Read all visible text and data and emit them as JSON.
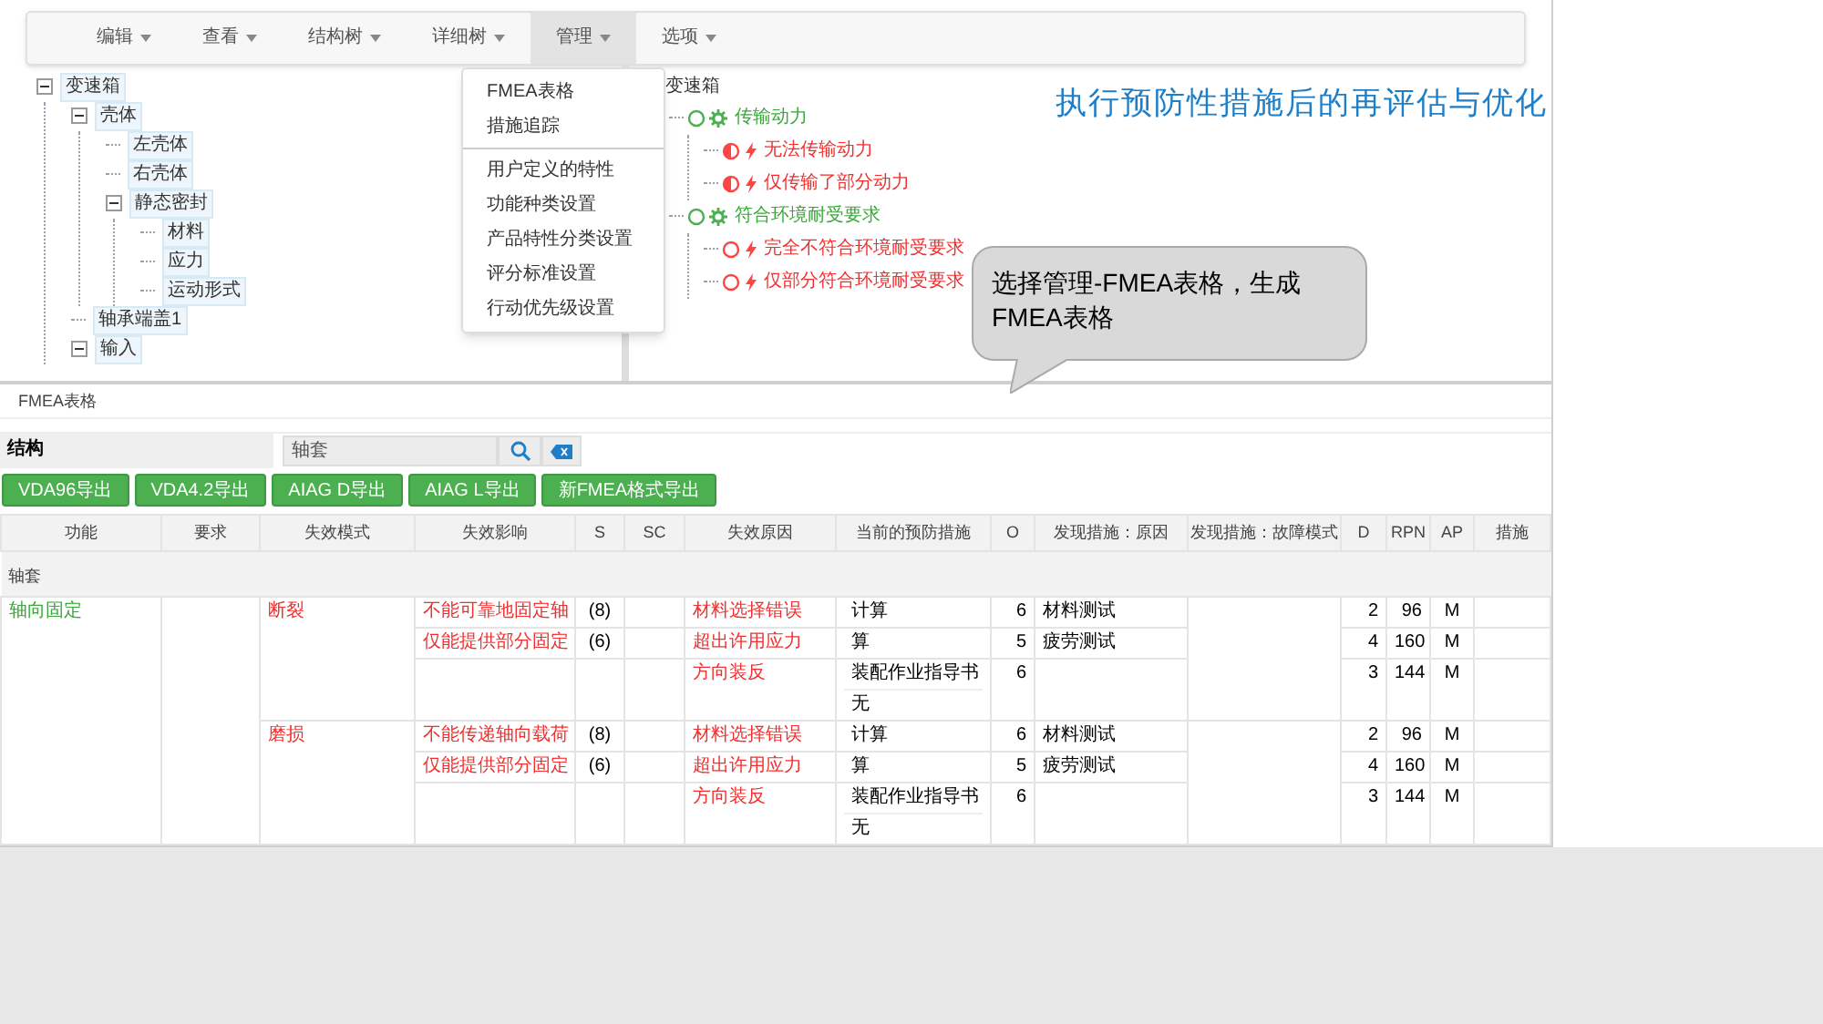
{
  "menu_bar": [
    {
      "label": "编辑",
      "selected": false
    },
    {
      "label": "查看",
      "selected": false
    },
    {
      "label": "结构树",
      "selected": false
    },
    {
      "label": "详细树",
      "selected": false
    },
    {
      "label": "管理",
      "selected": true
    },
    {
      "label": "选项",
      "selected": false
    }
  ],
  "dropdown": [
    [
      "FMEA表格",
      "措施追踪"
    ],
    [
      "用户定义的特性",
      "功能种类设置",
      "产品特性分类设置",
      "评分标准设置",
      "行动优先级设置"
    ]
  ],
  "structure_tree": [
    {
      "label": "变速箱",
      "expanded": true,
      "children": [
        {
          "label": "壳体",
          "expanded": true,
          "children": [
            {
              "label": "左壳体"
            },
            {
              "label": "右壳体"
            },
            {
              "label": "静态密封",
              "expanded": true,
              "children": [
                {
                  "label": "材料"
                },
                {
                  "label": "应力"
                },
                {
                  "label": "运动形式"
                }
              ]
            }
          ]
        },
        {
          "label": "轴承端盖1"
        },
        {
          "label": "输入",
          "expanded": true
        }
      ]
    }
  ],
  "function_tree": {
    "root": "变速箱",
    "items": [
      {
        "kind": "function",
        "label": "传输动力",
        "children": [
          {
            "kind": "failure",
            "label": "无法传输动力",
            "assessed": true
          },
          {
            "kind": "failure",
            "label": "仅传输了部分动力",
            "assessed": true
          }
        ]
      },
      {
        "kind": "function",
        "label": "符合环境耐受要求",
        "children": [
          {
            "kind": "failure",
            "label": "完全不符合环境耐受要求",
            "assessed": false
          },
          {
            "kind": "failure",
            "label": "仅部分符合环境耐受要求",
            "assessed": false
          }
        ]
      }
    ]
  },
  "slide_title": "执行预防性措施后的再评估与优化",
  "callout": "选择管理-FMEA表格，生成FMEA表格",
  "fmea_panel": {
    "title": "FMEA表格",
    "structure_label": "结构",
    "search_value": "轴套",
    "export_buttons": [
      "VDA96导出",
      "VDA4.2导出",
      "AIAG D导出",
      "AIAG L导出",
      "新FMEA格式导出"
    ],
    "columns": [
      "功能",
      "要求",
      "失效模式",
      "失效影响",
      "S",
      "SC",
      "失效原因",
      "当前的预防措施",
      "O",
      "发现措施：原因",
      "发现措施：故障模式",
      "D",
      "RPN",
      "AP",
      "措施"
    ],
    "group_label": "轴套",
    "function": "轴向固定",
    "failure_modes": [
      {
        "mode": "断裂",
        "rows": [
          {
            "effect": "不能可靠地固定轴",
            "s": "(8)",
            "cause": "材料选择错误",
            "prevention": [
              "计算"
            ],
            "o": "6",
            "detection_cause": "材料测试",
            "d": "2",
            "rpn": "96",
            "ap": "M"
          },
          {
            "effect": "仅能提供部分固定",
            "s": "(6)",
            "cause": "超出许用应力",
            "prevention": [
              "算"
            ],
            "o": "5",
            "detection_cause": "疲劳测试",
            "d": "4",
            "rpn": "160",
            "ap": "M"
          },
          {
            "cause": "方向装反",
            "prevention": [
              "装配作业指导书",
              "无"
            ],
            "o": "6",
            "d": "3",
            "rpn": "144",
            "ap": "M"
          }
        ]
      },
      {
        "mode": "磨损",
        "rows": [
          {
            "effect": "不能传递轴向载荷",
            "s": "(8)",
            "cause": "材料选择错误",
            "prevention": [
              "计算"
            ],
            "o": "6",
            "detection_cause": "材料测试",
            "d": "2",
            "rpn": "96",
            "ap": "M"
          },
          {
            "effect": "仅能提供部分固定",
            "s": "(6)",
            "cause": "超出许用应力",
            "prevention": [
              "算"
            ],
            "o": "5",
            "detection_cause": "疲劳测试",
            "d": "4",
            "rpn": "160",
            "ap": "M"
          },
          {
            "cause": "方向装反",
            "prevention": [
              "装配作业指导书",
              "无"
            ],
            "o": "6",
            "d": "3",
            "rpn": "144",
            "ap": "M"
          }
        ]
      }
    ]
  }
}
